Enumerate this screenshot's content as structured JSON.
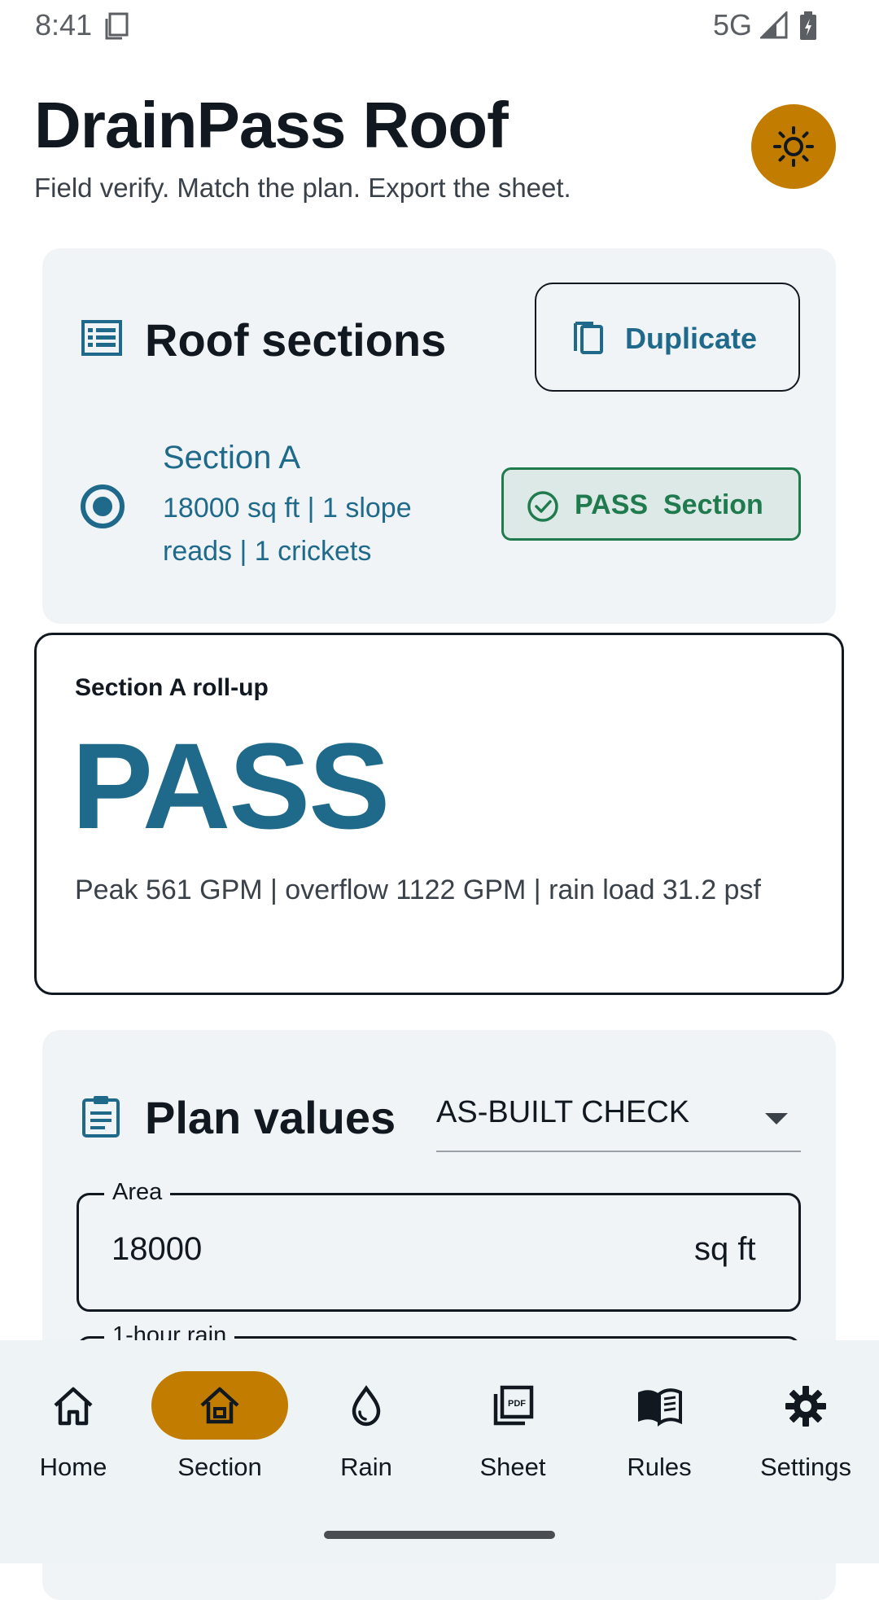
{
  "status_bar": {
    "time": "8:41",
    "network": "5G"
  },
  "header": {
    "title": "DrainPass Roof",
    "subtitle": "Field verify. Match the plan. Export the sheet."
  },
  "sections_card": {
    "title": "Roof sections",
    "duplicate_label": "Duplicate",
    "section": {
      "name": "Section A",
      "meta": "18000 sq ft | 1 slope reads | 1 crickets",
      "status_word": "PASS",
      "status_suffix": "Section"
    }
  },
  "rollup": {
    "title": "Section A roll-up",
    "result": "PASS",
    "stats": "Peak 561 GPM | overflow 1122 GPM | rain load 31.2 psf"
  },
  "plan_card": {
    "title": "Plan values",
    "mode": "AS-BUILT CHECK",
    "fields": [
      {
        "label": "Area",
        "value": "18000",
        "unit": "sq ft"
      },
      {
        "label": "1-hour rain"
      }
    ]
  },
  "nav": {
    "items": [
      {
        "label": "Home",
        "icon": "home-icon"
      },
      {
        "label": "Section",
        "icon": "roof-section-icon"
      },
      {
        "label": "Rain",
        "icon": "rain-drop-icon"
      },
      {
        "label": "Sheet",
        "icon": "pdf-icon"
      },
      {
        "label": "Rules",
        "icon": "book-icon"
      },
      {
        "label": "Settings",
        "icon": "gear-icon"
      }
    ],
    "active": "Section"
  },
  "colors": {
    "accent": "#c27d00",
    "primary": "#1f6a8a",
    "pass_green": "#1f7a4e",
    "card_bg": "#f0f4f7"
  }
}
